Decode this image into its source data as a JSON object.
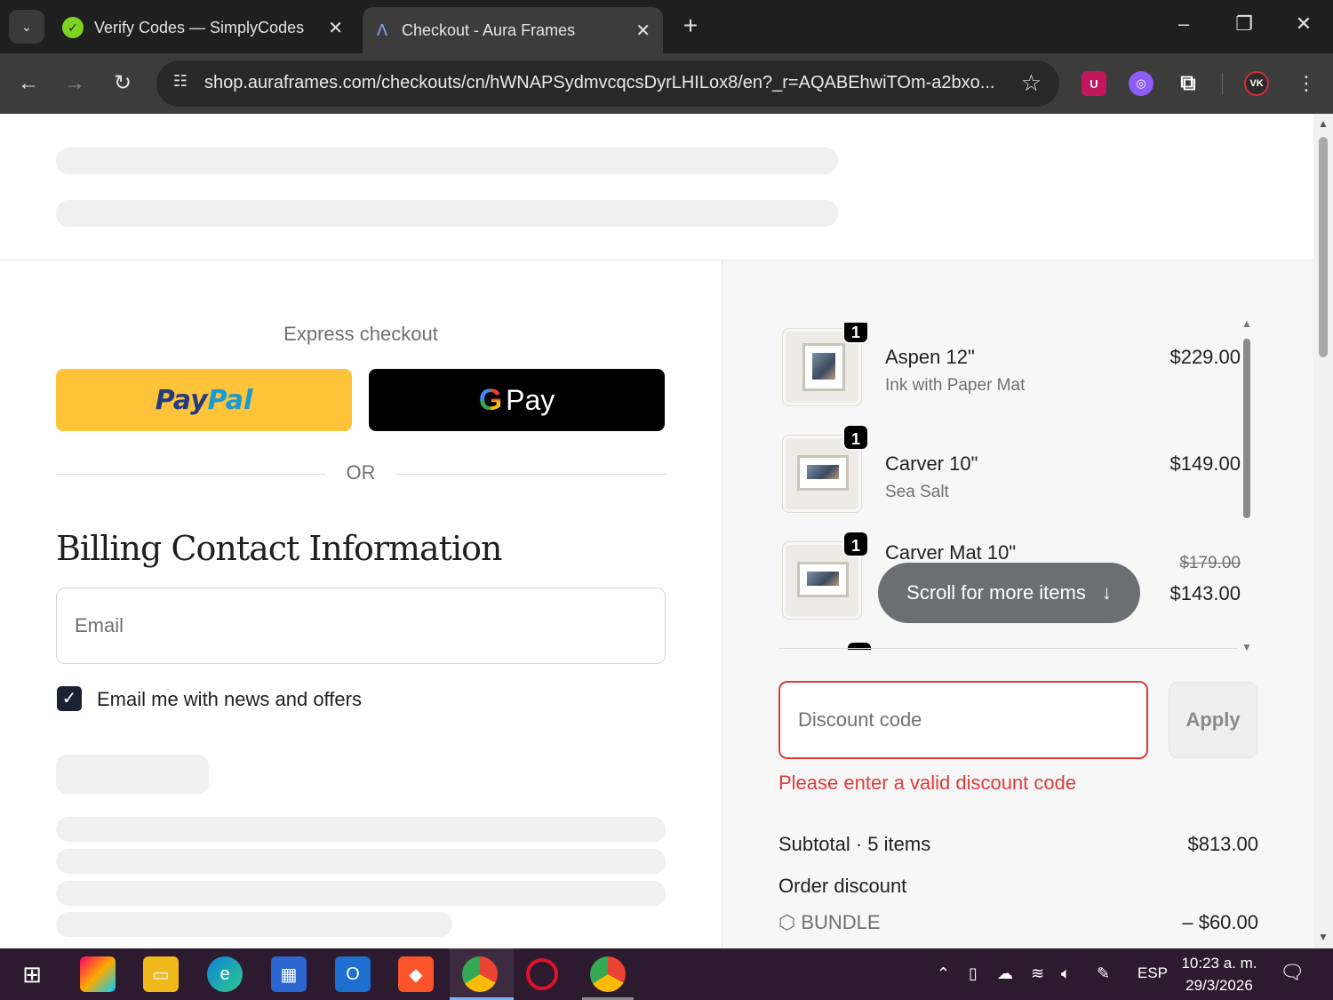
{
  "browser": {
    "tabs": [
      {
        "title": "Verify Codes — SimplyCodes",
        "active": false
      },
      {
        "title": "Checkout - Aura Frames",
        "active": true
      }
    ],
    "url": "shop.auraframes.com/checkouts/cn/hWNAPSydmvcqcsDyrLHILox8/en?_r=AQABEhwiTOm-a2bxo..."
  },
  "checkout": {
    "express_label": "Express checkout",
    "paypal_part1": "Pay",
    "paypal_part2": "Pal",
    "gpay_g": "G",
    "gpay_label": "Pay",
    "or_label": "OR",
    "billing_title": "Billing Contact Information",
    "email_placeholder": "Email",
    "newsletter_label": "Email me with news and offers",
    "newsletter_checked": true
  },
  "summary": {
    "items": [
      {
        "qty": "1",
        "name": "Aspen 12\"",
        "variant": "Ink with Paper Mat",
        "price": "$229.00"
      },
      {
        "qty": "1",
        "name": "Carver 10\"",
        "variant": "Sea Salt",
        "price": "$149.00"
      },
      {
        "qty": "1",
        "name": "Carver Mat 10\"",
        "old_price": "$179.00",
        "price": "$143.00"
      }
    ],
    "scroll_hint": "Scroll for more items",
    "discount_placeholder": "Discount code",
    "apply_label": "Apply",
    "error": "Please enter a valid discount code",
    "subtotal_label": "Subtotal · 5 items",
    "subtotal_value": "$813.00",
    "order_discount_label": "Order discount",
    "discount_code": "BUNDLE",
    "discount_value": "– $60.00"
  },
  "taskbar": {
    "language": "ESP",
    "time": "10:23 a. m.",
    "date": "29/3/2026"
  },
  "colors": {
    "error": "#dd3b3b",
    "paypal_yellow": "#ffc439",
    "taskbar": "#2c1a2e"
  }
}
